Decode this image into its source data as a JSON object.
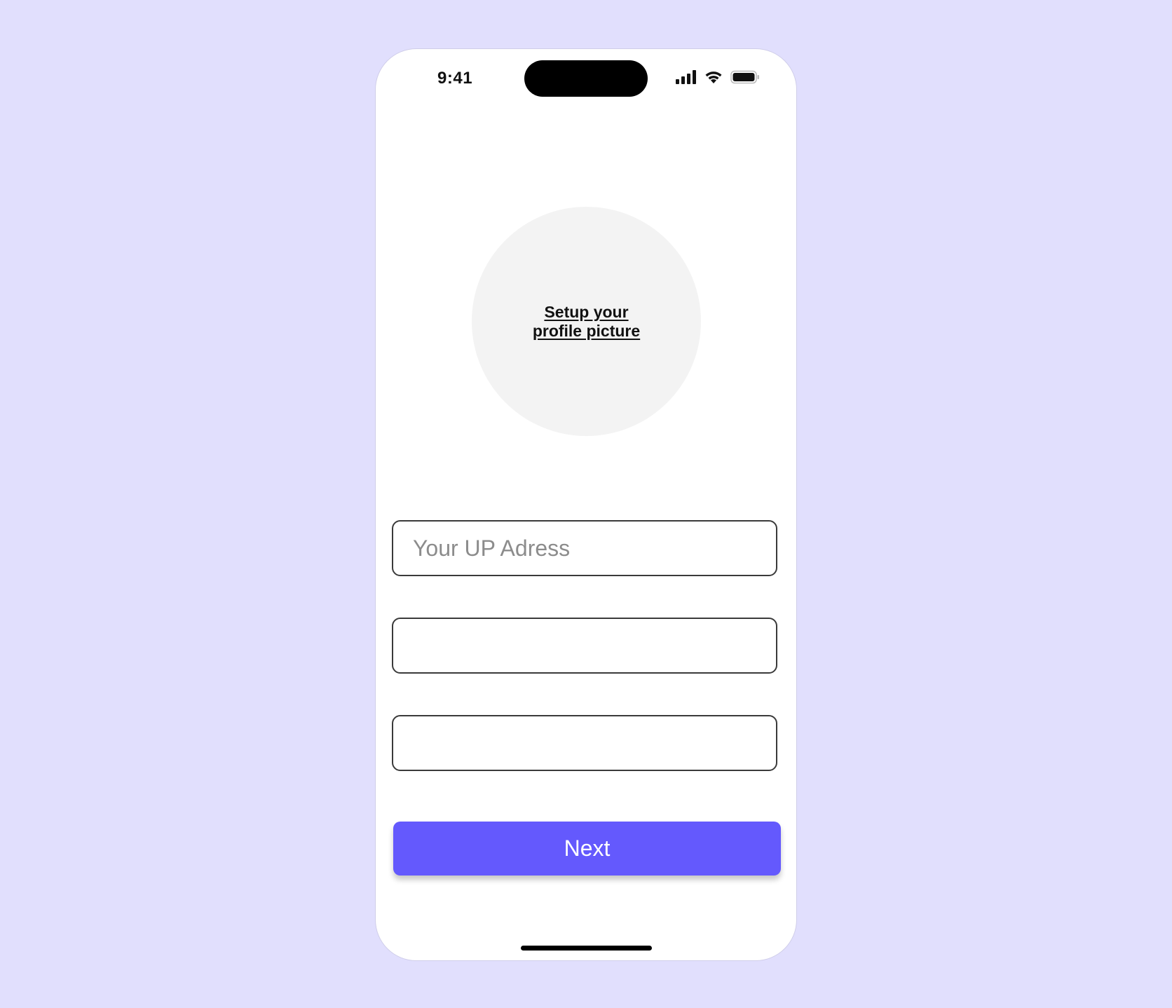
{
  "status_bar": {
    "time": "9:41",
    "icons": [
      "cellular-signal-icon",
      "wifi-icon",
      "battery-icon"
    ]
  },
  "profile": {
    "setup_label_line1": "Setup your",
    "setup_label_line2": "profile picture"
  },
  "form": {
    "up_address": {
      "value": "",
      "placeholder": "Your UP Adress"
    },
    "field_2": {
      "value": "",
      "placeholder": ""
    },
    "field_3": {
      "value": "",
      "placeholder": ""
    }
  },
  "actions": {
    "next_label": "Next"
  },
  "colors": {
    "background": "#e1dffd",
    "accent": "#6459fd",
    "avatar_fill": "#f3f3f3",
    "field_border": "#3a3a3a"
  }
}
